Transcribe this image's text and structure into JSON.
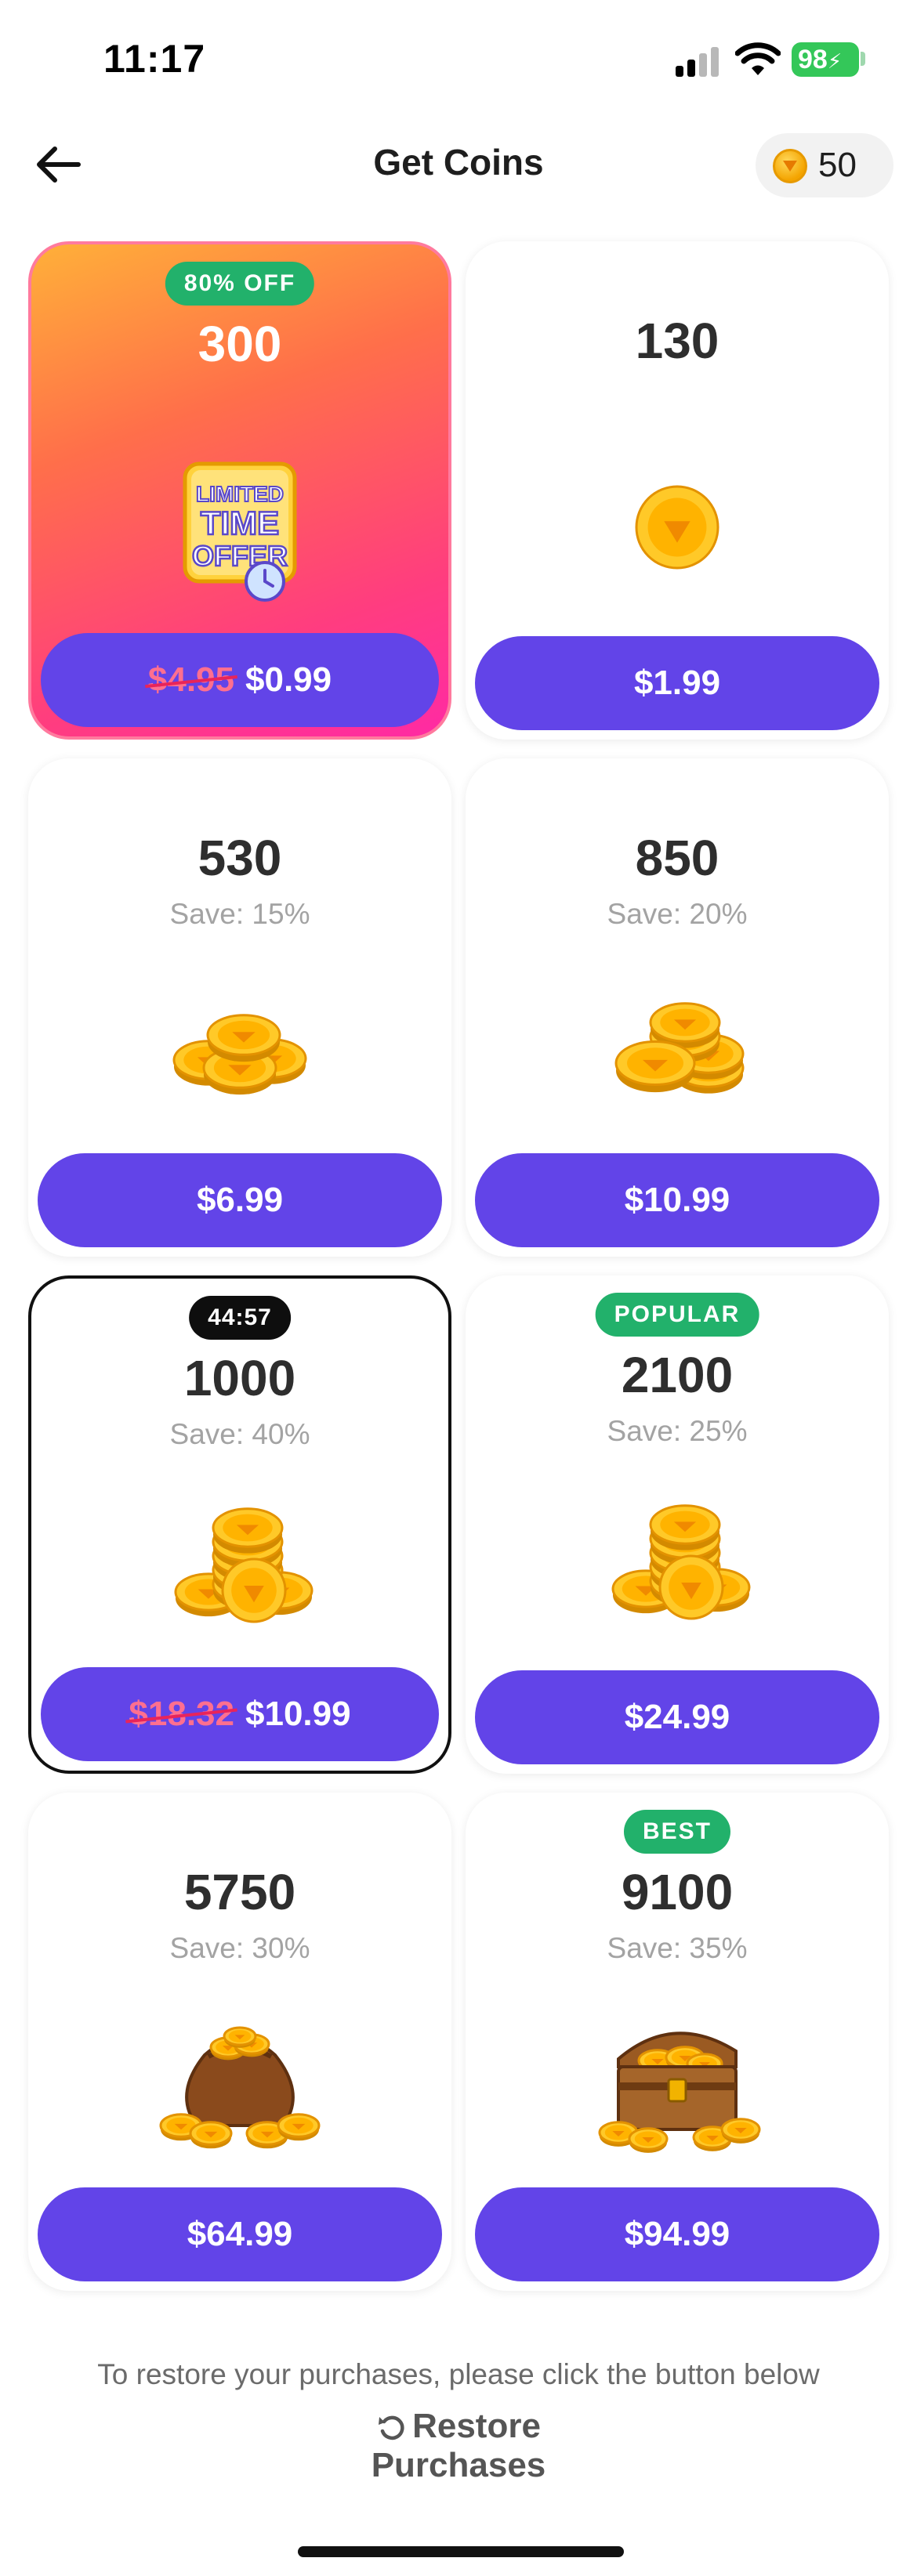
{
  "status_bar": {
    "time": "11:17",
    "battery": "98"
  },
  "header": {
    "title": "Get Coins",
    "coin_balance": "50",
    "back_icon": "arrow-left-icon",
    "coin_icon": "coin-icon"
  },
  "colors": {
    "accent": "#6244e8",
    "badge_green": "#22b16b",
    "badge_black": "#0e0e0e",
    "strike": "#e8245a"
  },
  "packages": [
    {
      "badge": "80% OFF",
      "amount": "300",
      "save": "",
      "old_price": "$4.95",
      "price": "$0.99",
      "art": "limited-time-offer-icon"
    },
    {
      "badge": "",
      "amount": "130",
      "save": "",
      "old_price": "",
      "price": "$1.99",
      "art": "single-coin-icon"
    },
    {
      "badge": "",
      "amount": "530",
      "save": "Save: 15%",
      "old_price": "",
      "price": "$6.99",
      "art": "coin-pile-small-icon"
    },
    {
      "badge": "",
      "amount": "850",
      "save": "Save: 20%",
      "old_price": "",
      "price": "$10.99",
      "art": "coin-stack-icon"
    },
    {
      "badge": "44:57",
      "amount": "1000",
      "save": "Save: 40%",
      "old_price": "$18.32",
      "price": "$10.99",
      "art": "coin-stack-large-icon"
    },
    {
      "badge": "POPULAR",
      "amount": "2100",
      "save": "Save: 25%",
      "old_price": "",
      "price": "$24.99",
      "art": "coin-stack-large-icon"
    },
    {
      "badge": "",
      "amount": "5750",
      "save": "Save: 30%",
      "old_price": "",
      "price": "$64.99",
      "art": "coin-bag-icon"
    },
    {
      "badge": "BEST",
      "amount": "9100",
      "save": "Save: 35%",
      "old_price": "",
      "price": "$94.99",
      "art": "treasure-chest-icon"
    }
  ],
  "limited_offer_text": {
    "line1": "LIMITED",
    "line2": "TIME",
    "line3": "OFFER"
  },
  "footer": {
    "note": "To restore your purchases, please click the button below",
    "restore_label": "Restore Purchases",
    "restore_icon": "refresh-icon"
  }
}
